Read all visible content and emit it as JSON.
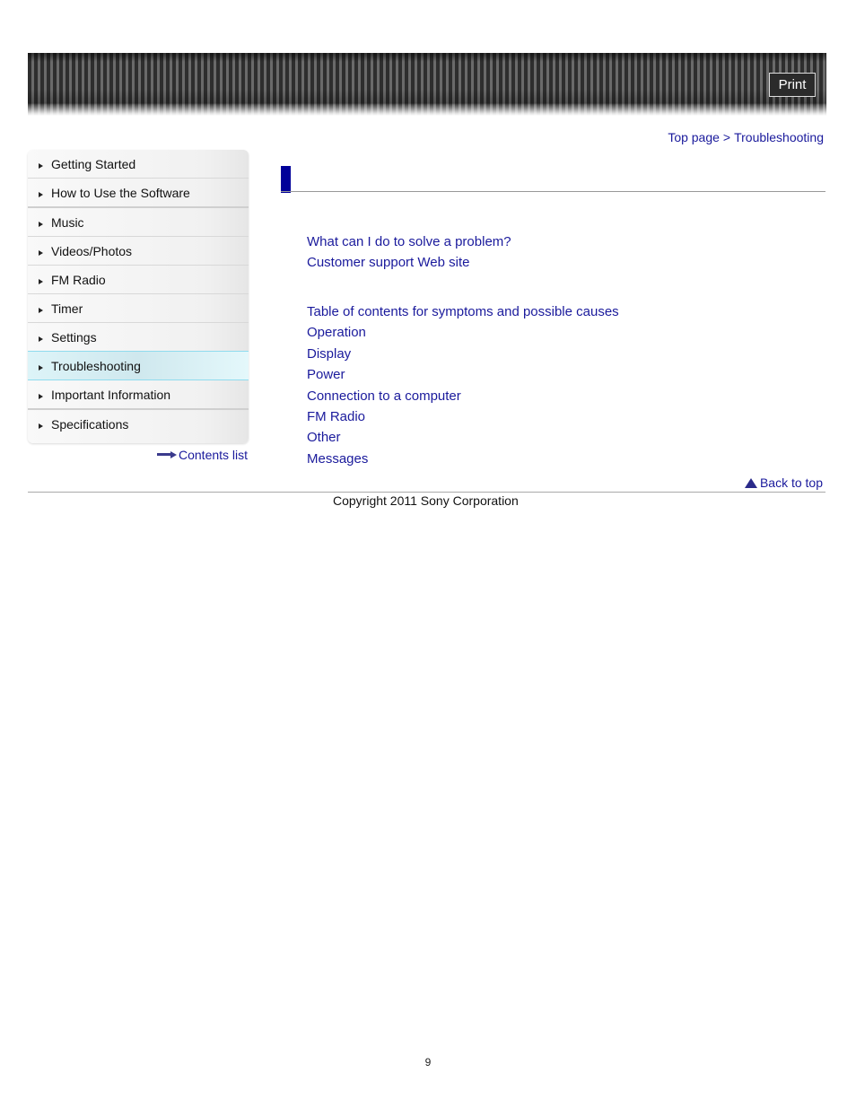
{
  "header": {
    "print_label": "Print"
  },
  "breadcrumb": {
    "items": [
      "Top page",
      "Troubleshooting"
    ],
    "separator": ">"
  },
  "sidebar": {
    "items": [
      {
        "label": "Getting Started"
      },
      {
        "label": "How to Use the Software"
      },
      {
        "label": "Music"
      },
      {
        "label": "Videos/Photos"
      },
      {
        "label": "FM Radio"
      },
      {
        "label": "Timer"
      },
      {
        "label": "Settings"
      },
      {
        "label": "Troubleshooting",
        "active": true
      },
      {
        "label": "Important Information"
      },
      {
        "label": "Specifications"
      }
    ],
    "contents_list_label": "Contents list"
  },
  "main": {
    "group1": [
      "What can I do to solve a problem?",
      "Customer support Web site"
    ],
    "group2": [
      "Table of contents for symptoms and possible causes",
      "Operation",
      "Display",
      "Power",
      "Connection to a computer",
      "FM Radio",
      "Other",
      "Messages"
    ],
    "back_to_top_label": "Back to top"
  },
  "footer": {
    "copyright": "Copyright 2011 Sony Corporation",
    "page_number": "9"
  },
  "colors": {
    "link": "#1a1a9c",
    "heading_bar": "#000099",
    "active_nav": "#d6eff4"
  }
}
